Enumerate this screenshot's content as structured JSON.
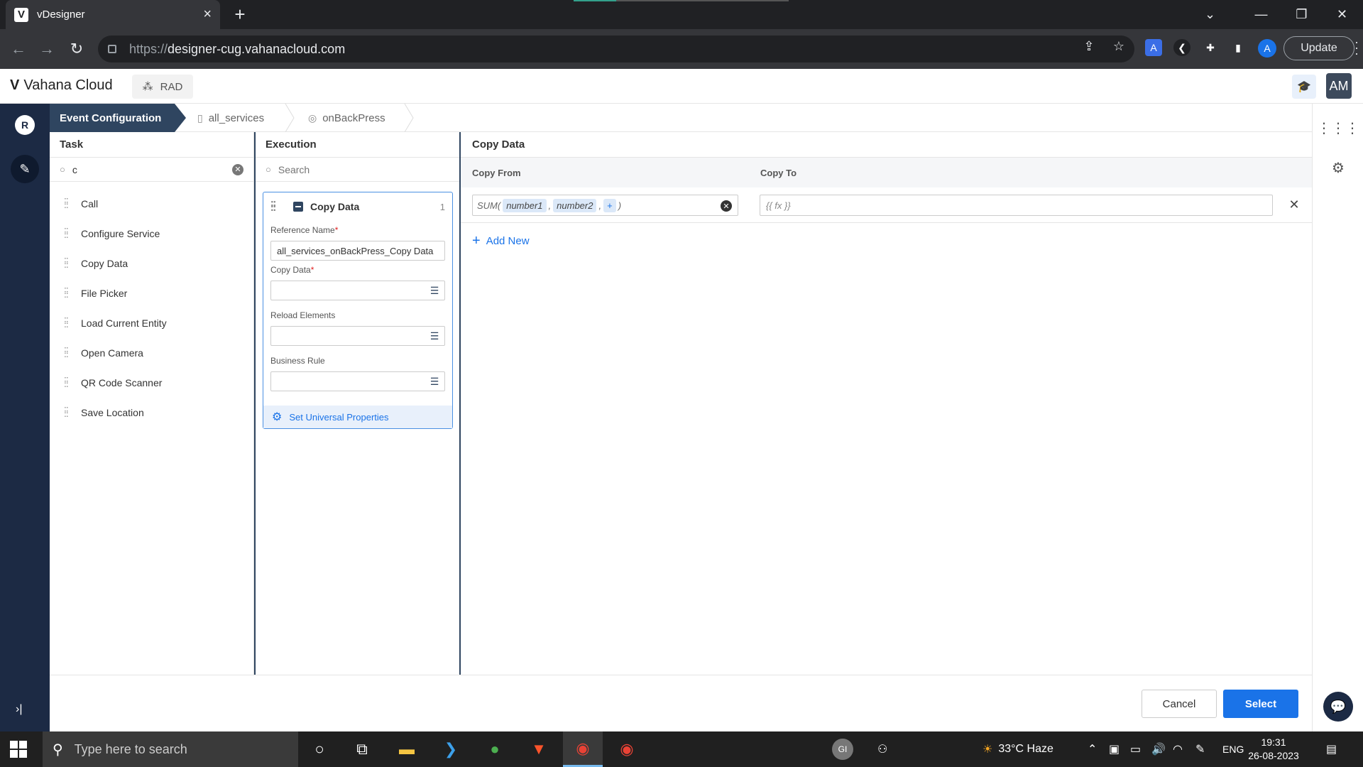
{
  "browser": {
    "tab_title": "vDesigner",
    "tab_favicon": "V",
    "url_scheme": "https://",
    "url_host": "designer-cug.vahanacloud.com",
    "profile_initial": "A",
    "update_label": "Update"
  },
  "app": {
    "brand": "Vahana Cloud",
    "workspace": "RAD",
    "avatar_initials": "AM",
    "rail_initial": "R"
  },
  "breadcrumb": {
    "active": "Event Configuration",
    "items": [
      "all_services",
      "onBackPress"
    ]
  },
  "task_panel": {
    "title": "Task",
    "search_value": "c",
    "items": [
      "Call",
      "Configure Service",
      "Copy Data",
      "File Picker",
      "Load Current Entity",
      "Open Camera",
      "QR Code Scanner",
      "Save Location"
    ]
  },
  "execution_panel": {
    "title": "Execution",
    "search_placeholder": "Search",
    "card": {
      "title": "Copy Data",
      "index": "1",
      "reference_name_label": "Reference Name",
      "reference_name_value": "all_services_onBackPress_Copy Data",
      "copy_data_label": "Copy Data",
      "reload_elements_label": "Reload Elements",
      "business_rule_label": "Business Rule",
      "universal_label": "Set Universal Properties"
    }
  },
  "copy_panel": {
    "title": "Copy Data",
    "col_from": "Copy From",
    "col_to": "Copy To",
    "row": {
      "fn_open": "SUM(",
      "arg1": "number1",
      "sep1": ",",
      "arg2": "number2",
      "sep2": ",",
      "plus": "+",
      "fn_close": ")",
      "to_placeholder": "{{ fx }}"
    },
    "add_new_label": "Add New"
  },
  "footer": {
    "cancel_label": "Cancel",
    "select_label": "Select"
  },
  "taskbar": {
    "search_placeholder": "Type here to search",
    "weather": "33°C  Haze",
    "language": "ENG",
    "time": "19:31",
    "date": "26-08-2023",
    "gi_label": "GI"
  },
  "colors": {
    "primary": "#1a73e8",
    "rail": "#1c2a44",
    "crumb_active": "#2f4560",
    "required": "#e02020"
  }
}
